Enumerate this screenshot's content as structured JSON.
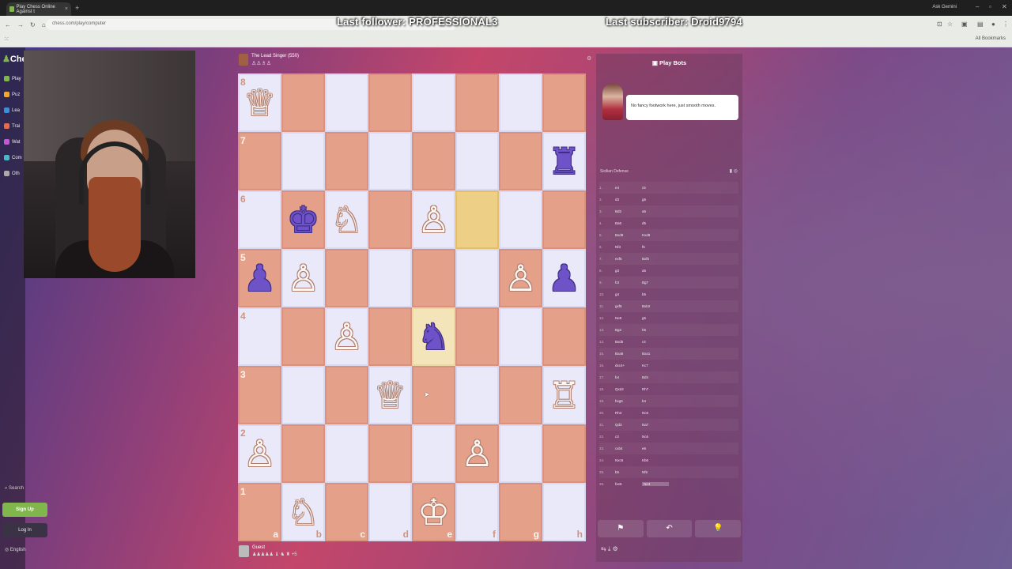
{
  "browser": {
    "tab_title": "Play Chess Online Against t",
    "tab_close": "×",
    "new_tab": "+",
    "url": "chess.com/play/computer",
    "ask_gemini": "Ask Gemini",
    "all_bookmarks": "All Bookmarks"
  },
  "overlay": {
    "last_follower": "Last follower: PROFESSIONAL3",
    "last_subscriber": "Last subscriber: Droid9794"
  },
  "sidebar": {
    "logo": "Ches",
    "items": [
      {
        "label": "Play",
        "color": "#81b64c"
      },
      {
        "label": "Puz",
        "color": "#f0a830"
      },
      {
        "label": "Lea",
        "color": "#3c8fd6"
      },
      {
        "label": "Trai",
        "color": "#e86a4a"
      },
      {
        "label": "Wat",
        "color": "#c05ad0"
      },
      {
        "label": "Com",
        "color": "#4ab6c8"
      },
      {
        "label": "Oth",
        "color": "#aaaaaa"
      }
    ],
    "search": "Search",
    "signup": "Sign Up",
    "login": "Log In",
    "language": "English"
  },
  "top_player": {
    "name": "The Lead Singer (550)",
    "captured": "♙♙♗♙"
  },
  "bottom_player": {
    "name": "Guest",
    "captured": "♟♟♟♟♟ ♝ ♞ ♜ +5"
  },
  "board": {
    "ranks": [
      "8",
      "7",
      "6",
      "5",
      "4",
      "3",
      "2",
      "1"
    ],
    "files": [
      "a",
      "b",
      "c",
      "d",
      "e",
      "f",
      "g",
      "h"
    ],
    "pieces": {
      "a8": {
        "g": "♕",
        "c": "w"
      },
      "h7": {
        "g": "♜",
        "c": "b"
      },
      "b6": {
        "g": "♚",
        "c": "b"
      },
      "c6": {
        "g": "♘",
        "c": "w"
      },
      "e6": {
        "g": "♙",
        "c": "w"
      },
      "a5": {
        "g": "♟",
        "c": "b"
      },
      "b5": {
        "g": "♙",
        "c": "w"
      },
      "g5": {
        "g": "♙",
        "c": "w"
      },
      "h5": {
        "g": "♟",
        "c": "b"
      },
      "c4": {
        "g": "♙",
        "c": "w"
      },
      "e4": {
        "g": "♞",
        "c": "b"
      },
      "d3": {
        "g": "♕",
        "c": "w"
      },
      "h3": {
        "g": "♖",
        "c": "w"
      },
      "a2": {
        "g": "♙",
        "c": "w"
      },
      "f2": {
        "g": "♙",
        "c": "w"
      },
      "b1": {
        "g": "♘",
        "c": "w"
      },
      "e1": {
        "g": "♔",
        "c": "w"
      }
    },
    "highlight": [
      "f6",
      "e4"
    ]
  },
  "panel": {
    "title": "Play Bots",
    "bubble": "No fancy footwork here, just smooth moves.",
    "opening": "Sicilian Defense",
    "moves": [
      {
        "n": "1.",
        "w": "e4",
        "b": "c5"
      },
      {
        "n": "2.",
        "w": "d3",
        "b": "g6"
      },
      {
        "n": "3.",
        "w": "Bd2",
        "b": "a6"
      },
      {
        "n": "4.",
        "w": "Ba5",
        "b": "d5"
      },
      {
        "n": "5.",
        "w": "Bxd8",
        "b": "Kxd8"
      },
      {
        "n": "6.",
        "w": "Nf3",
        "b": "f5"
      },
      {
        "n": "7.",
        "w": "exf5",
        "b": "Bxf5"
      },
      {
        "n": "8.",
        "w": "g3",
        "b": "a5"
      },
      {
        "n": "9.",
        "w": "h3",
        "b": "Bg7"
      },
      {
        "n": "10.",
        "w": "g4",
        "b": "b5"
      },
      {
        "n": "11.",
        "w": "gxf5",
        "b": "Bxb2"
      },
      {
        "n": "12.",
        "w": "Ne5",
        "b": "g5"
      },
      {
        "n": "13.",
        "w": "Bg2",
        "b": "h5"
      },
      {
        "n": "14.",
        "w": "Bxd5",
        "b": "c4"
      },
      {
        "n": "15.",
        "w": "Bxa8",
        "b": "Bxa1"
      },
      {
        "n": "16.",
        "w": "dxc4+",
        "b": "Kc7"
      },
      {
        "n": "17.",
        "w": "b4",
        "b": "Bd4"
      },
      {
        "n": "18.",
        "w": "Qxd4",
        "b": "Rh7"
      },
      {
        "n": "19.",
        "w": "hxg5",
        "b": "b4"
      },
      {
        "n": "20.",
        "w": "Rh3",
        "b": "Nc6"
      },
      {
        "n": "21.",
        "w": "Qd3",
        "b": "Na7"
      },
      {
        "n": "22.",
        "w": "c3",
        "b": "Nc6"
      },
      {
        "n": "23.",
        "w": "cxb4",
        "b": "e6"
      },
      {
        "n": "24.",
        "w": "Nxc6",
        "b": "Kb6"
      },
      {
        "n": "25.",
        "w": "b5",
        "b": "Nf6"
      },
      {
        "n": "26.",
        "w": "fxe6",
        "b": "Ne4"
      }
    ],
    "controls": [
      "⚑",
      "↶",
      "💡"
    ],
    "sub_controls": "⇆ ⤓ ⚙"
  }
}
